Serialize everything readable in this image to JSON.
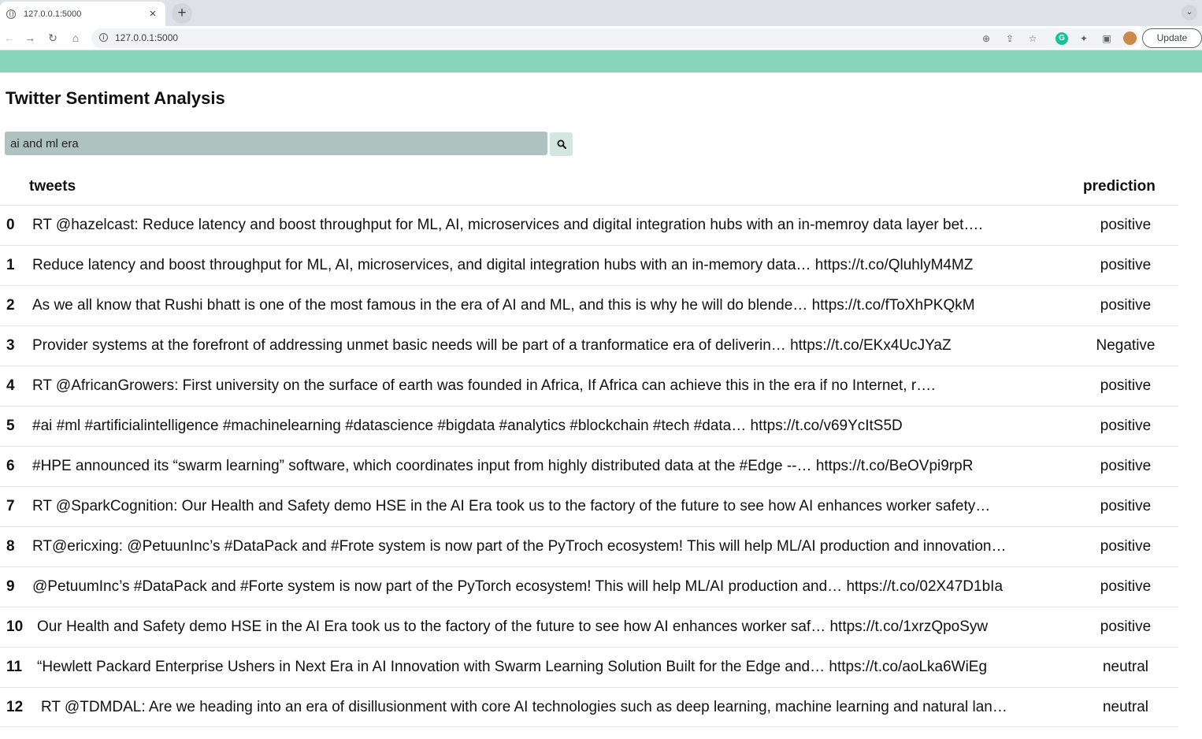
{
  "browser": {
    "tab_title": "127.0.0.1:5000",
    "tab_close": "×",
    "new_tab": "+",
    "tab_menu": "⌄",
    "url": "127.0.0.1:5000",
    "update_label": "Update",
    "icons": [
      "globe-icon",
      "back-icon",
      "forward-icon",
      "reload-icon",
      "home-icon",
      "site-info-icon",
      "zoom-icon",
      "share-icon",
      "bookmark-star-icon",
      "grammarly-icon",
      "extensions-puzzle-icon",
      "side-panel-icon",
      "profile-avatar"
    ]
  },
  "page": {
    "banner_color": "#87d4bb",
    "title": "Twitter Sentiment Analysis",
    "search": {
      "value": "ai and ml era",
      "input_bg": "#aec3bf"
    },
    "table": {
      "headers": {
        "tweets": "tweets",
        "prediction": "prediction"
      },
      "rows": [
        {
          "index": "0",
          "tweet": "RT @hazelcast: Reduce latency and boost throughput for ML, AI, microservices and digital integration hubs with an in-memroy data layer bet….",
          "prediction": "positive"
        },
        {
          "index": "1",
          "tweet": "Reduce latency and boost throughput for ML, AI, microservices, and digital integration hubs with an in-memory data… https://t.co/QluhlyM4MZ",
          "prediction": "positive"
        },
        {
          "index": "2",
          "tweet": "As we all know that Rushi bhatt is one of the most famous in the era of AI and ML, and this is why he will do blende… https://t.co/fToXhPKQkM",
          "prediction": "positive"
        },
        {
          "index": "3",
          "tweet": "Provider systems at the forefront of addressing unmet basic needs will be part of a tranformatice era of deliverin… https://t.co/EKx4UcJYaZ",
          "prediction": "Negative"
        },
        {
          "index": "4",
          "tweet": "RT @AfricanGrowers: First university on the surface of earth was founded in Africa, If Africa can achieve this in the era if no Internet, r….",
          "prediction": "positive"
        },
        {
          "index": "5",
          "tweet": "#ai #ml #artificialintelligence #machinelearning #datascience #bigdata #analytics #blockchain #tech #data… https://t.co/v69YcItS5D",
          "prediction": "positive"
        },
        {
          "index": "6",
          "tweet": "#HPE announced its “swarm learning” software, which coordinates input from highly distributed data at the #Edge --… https://t.co/BeOVpi9rpR",
          "prediction": "positive"
        },
        {
          "index": "7",
          "tweet": "RT @SparkCognition: Our Health and Safety demo HSE in the AI Era took us to the factory of the future to see how AI enhances worker safety…",
          "prediction": "positive"
        },
        {
          "index": "8",
          "tweet": "RT@ericxing: @PetuunInc’s #DataPack and #Frote system is now part of the PyTroch ecosystem! This will help ML/AI production and innovation…",
          "prediction": "positive"
        },
        {
          "index": "9",
          "tweet": "@PetuumInc’s #DataPack and #Forte system is now part of the PyTorch ecosystem! This will help ML/AI production and… https://t.co/02X47D1bIa",
          "prediction": "positive"
        },
        {
          "index": "10",
          "tweet": "Our Health and Safety demo HSE in the AI Era took us to the factory of the future to see how AI enhances worker saf… https://t.co/1xrzQpoSyw",
          "prediction": "positive"
        },
        {
          "index": "11",
          "tweet": "“Hewlett Packard Enterprise Ushers in Next Era in AI Innovation with Swarm Learning Solution Built for the Edge and… https://t.co/aoLka6WiEg",
          "prediction": "neutral"
        },
        {
          "index": "12",
          "tweet": "RT @TDMDAL: Are we heading into an era of disillusionment with core AI technologies such as deep learning, machine learning and natural lan…",
          "prediction": "neutral"
        }
      ]
    }
  }
}
